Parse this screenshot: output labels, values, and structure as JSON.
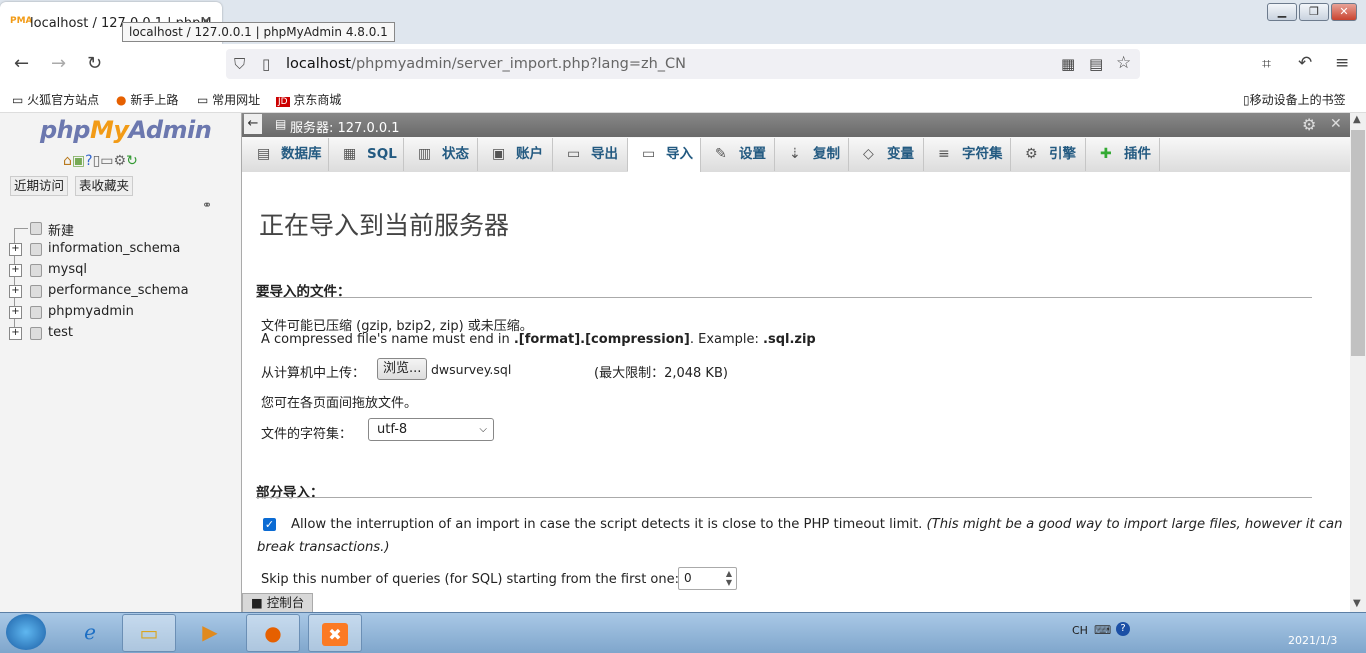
{
  "browser": {
    "tab_title": "localhost / 127.0.0.1 | phpM",
    "tooltip": "localhost / 127.0.0.1 | phpMyAdmin 4.8.0.1",
    "url_host": "localhost",
    "url_path": "/phpmyadmin/server_import.php?lang=zh_CN",
    "bookmarks": [
      "火狐官方站点",
      "新手上路",
      "常用网址",
      "京东商城"
    ],
    "mobile_bookmarks": "移动设备上的书签"
  },
  "sidebar": {
    "logo_php": "php",
    "logo_my": "My",
    "logo_admin": "Admin",
    "recent_label": "近期访问",
    "favorites_label": "表收藏夹",
    "new_label": "新建",
    "databases": [
      "information_schema",
      "mysql",
      "performance_schema",
      "phpmyadmin",
      "test"
    ]
  },
  "serverbar": {
    "label": "服务器: 127.0.0.1"
  },
  "menu": {
    "tabs": [
      {
        "label": "数据库",
        "icon": "database-icon",
        "glyph": "▤"
      },
      {
        "label": "SQL",
        "icon": "sql-icon",
        "glyph": "▦"
      },
      {
        "label": "状态",
        "icon": "status-icon",
        "glyph": "▥"
      },
      {
        "label": "账户",
        "icon": "accounts-icon",
        "glyph": "▣"
      },
      {
        "label": "导出",
        "icon": "export-icon",
        "glyph": "▭"
      },
      {
        "label": "导入",
        "icon": "import-icon",
        "glyph": "▭"
      },
      {
        "label": "设置",
        "icon": "wrench-icon",
        "glyph": "✎"
      },
      {
        "label": "复制",
        "icon": "replication-icon",
        "glyph": "⇣"
      },
      {
        "label": "变量",
        "icon": "variables-icon",
        "glyph": "◇"
      },
      {
        "label": "字符集",
        "icon": "charset-icon",
        "glyph": "≡"
      },
      {
        "label": "引擎",
        "icon": "engine-icon",
        "glyph": "⚙"
      },
      {
        "label": "插件",
        "icon": "plugin-icon",
        "glyph": "✚"
      }
    ]
  },
  "main": {
    "title": "正在导入到当前服务器",
    "file_section": "要导入的文件：",
    "compress_note": "文件可能已压缩 (gzip, bzip2, zip) 或未压缩。",
    "name_note_prefix": "A compressed file's name must end in ",
    "name_note_format": ".[format].[compression]",
    "name_note_mid": ". Example: ",
    "name_note_example": ".sql.zip",
    "upload_label": "从计算机中上传：",
    "browse_label": "浏览...",
    "file_name": "dwsurvey.sql",
    "max_limit": "(最大限制：2,048 KB)",
    "drag_note": "您可在各页面间拖放文件。",
    "charset_label": "文件的字符集：",
    "charset_value": "utf-8",
    "partial_section": "部分导入：",
    "allow_interrupt": "Allow the interruption of an import in case the script detects it is close to the PHP timeout limit.",
    "allow_interrupt_italic_1": "(This might be a good way to import large files, however it can",
    "allow_interrupt_italic_2": "break transactions.)",
    "skip_label": "Skip this number of queries (for SQL) starting from the first one:",
    "skip_value": "0",
    "console_label": "控制台"
  },
  "taskbar": {
    "lang": "CH",
    "clock": "2021/1/3"
  }
}
